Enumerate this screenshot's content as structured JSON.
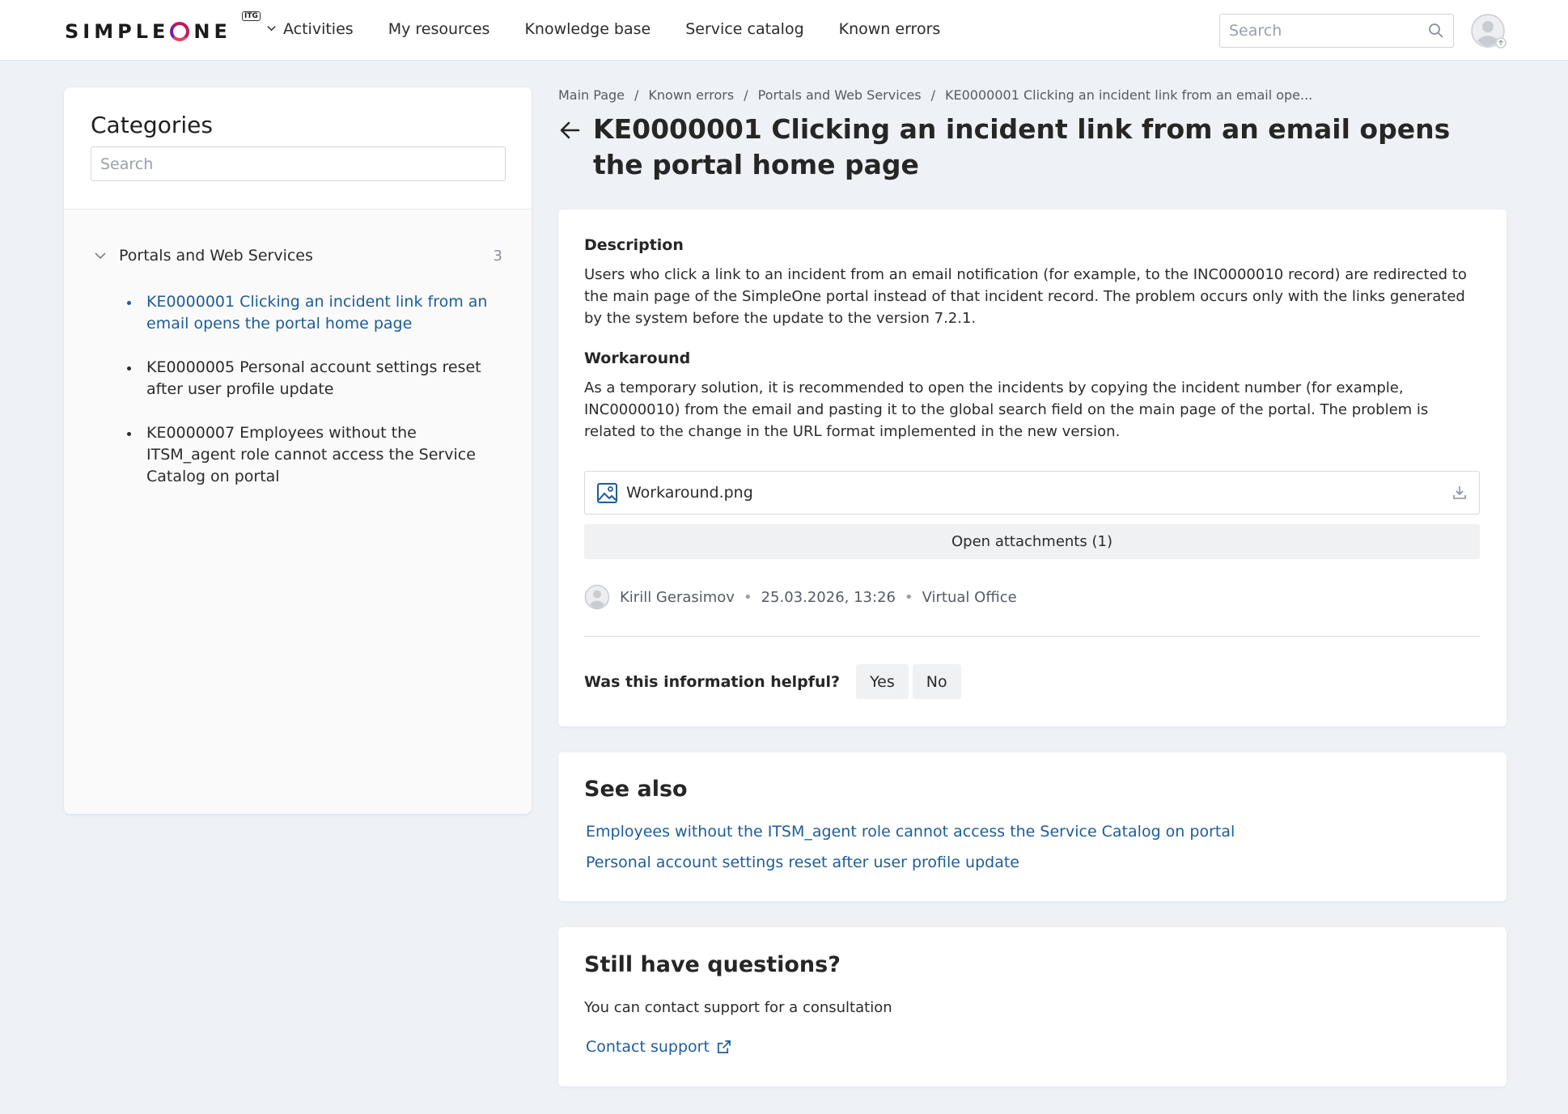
{
  "header": {
    "logo_text": "SIMPLEONE",
    "logo_badge": "ITG",
    "nav": [
      {
        "label": "Activities"
      },
      {
        "label": "My resources"
      },
      {
        "label": "Knowledge base"
      },
      {
        "label": "Service catalog"
      },
      {
        "label": "Known errors"
      }
    ],
    "search_placeholder": "Search"
  },
  "sidebar": {
    "title": "Categories",
    "search_placeholder": "Search",
    "category": {
      "label": "Portals and Web Services",
      "count": "3"
    },
    "items": [
      {
        "label": "KE0000001 Clicking an incident link from an email opens the portal home page",
        "active": true
      },
      {
        "label": "KE0000005 Personal account settings reset after user profile update",
        "active": false
      },
      {
        "label": "KE0000007 Employees without the ITSM_agent role cannot access the Service Catalog on portal",
        "active": false
      }
    ]
  },
  "breadcrumb": [
    "Main Page",
    "Known errors",
    "Portals and Web Services",
    "KE0000001 Clicking an incident link from an email ope..."
  ],
  "breadcrumb_sep": "/",
  "title": "KE0000001 Clicking an incident link from an email opens the portal home page",
  "article": {
    "description_heading": "Description",
    "description_text": "Users who click a link to an incident from an email notification (for example, to the INC0000010 record) are redirected to the main page of the SimpleOne portal instead of that incident record. The problem occurs only with the links generated by the system before the update to the version 7.2.1.",
    "workaround_heading": "Workaround",
    "workaround_text": "As a temporary solution, it is recommended to open the incidents by copying the incident number (for example, INC0000010) from the email and pasting it to the global search field on the main page of the portal. The problem is related to the change in the URL format implemented in the new version.",
    "attachment_name": "Workaround.png",
    "open_attachments_label": "Open attachments (1)",
    "author": "Kirill Gerasimov",
    "date": "25.03.2026, 13:26",
    "location": "Virtual Office",
    "meta_sep": "•",
    "helpful_question": "Was this information helpful?",
    "yes_label": "Yes",
    "no_label": "No"
  },
  "see_also": {
    "heading": "See also",
    "links": [
      "Employees without the ITSM_agent role cannot access the Service Catalog on portal",
      "Personal account settings reset after user profile update"
    ]
  },
  "questions": {
    "heading": "Still have questions?",
    "text": "You can contact support for a consultation",
    "contact_label": "Contact support"
  },
  "colors": {
    "accent_link": "#1d5d99",
    "background": "#eef1f6",
    "logo_ring": "#c2185b"
  }
}
